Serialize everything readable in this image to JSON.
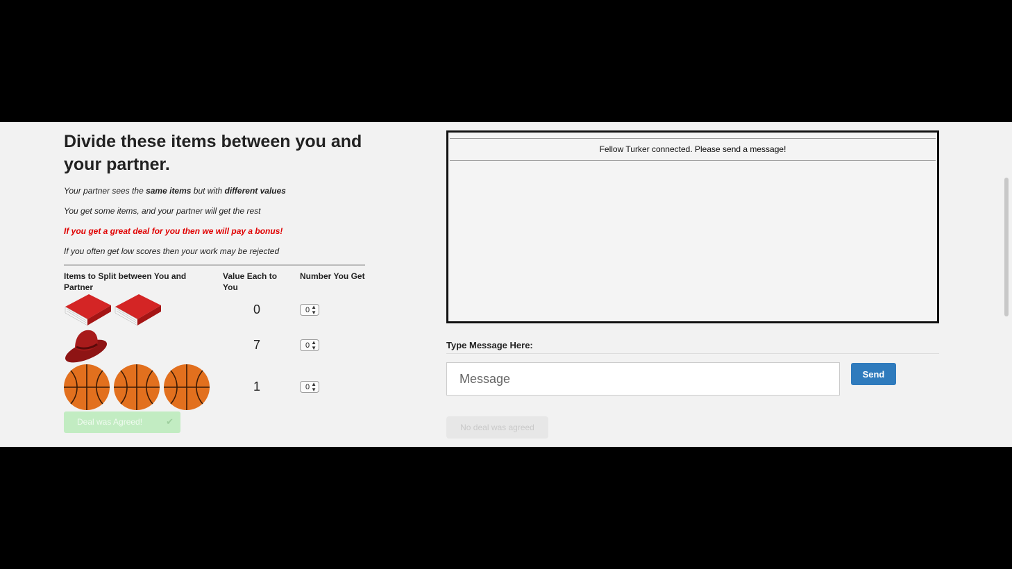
{
  "instructions": {
    "heading": "Divide these items between you and your partner.",
    "note1_a": "Your partner sees the ",
    "note1_b": "same items",
    "note1_c": " but with ",
    "note1_d": "different values",
    "note2": "You get some items, and your partner will get the rest",
    "note_bonus": "If you get a great deal for you then we will pay a bonus!",
    "note4": "If you often get low scores then your work may be rejected",
    "bonus_color": "#e00000"
  },
  "table": {
    "col_items": "Items to Split between You and Partner",
    "col_value": "Value Each to You",
    "col_count": "Number You Get",
    "rows": [
      {
        "item_icon": "book-icon",
        "quantity": 2,
        "value": "0",
        "selected": "0"
      },
      {
        "item_icon": "hat-icon",
        "quantity": 1,
        "value": "7",
        "selected": "0"
      },
      {
        "item_icon": "basketball-icon",
        "quantity": 3,
        "value": "1",
        "selected": "0"
      }
    ]
  },
  "deal_agreed_button": {
    "label": "Deal was Agreed!",
    "icon": "check-icon",
    "color": "#c2ecc2"
  },
  "chat": {
    "status": "Fellow Turker connected. Please send a message!",
    "message_label": "Type Message Here:",
    "message_placeholder": "Message",
    "send_label": "Send",
    "send_color": "#2f7bbd",
    "no_deal_label": "No deal was agreed"
  }
}
